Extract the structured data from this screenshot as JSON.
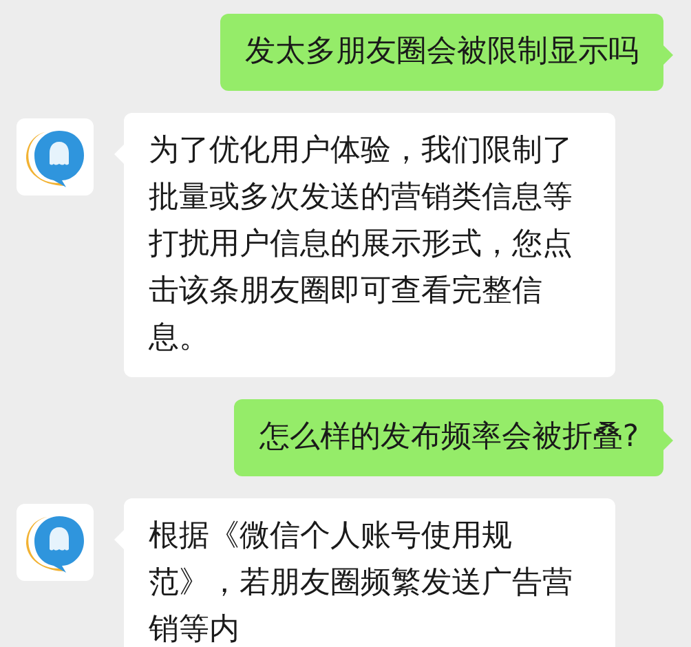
{
  "messages": [
    {
      "kind": "sent",
      "text": "发太多朋友圈会被限制显示吗"
    },
    {
      "kind": "received",
      "text": "为了优化用户体验，我们限制了批量或多次发送的营销类信息等打扰用户信息的展示形式，您点击该条朋友圈即可查看完整信息。"
    },
    {
      "kind": "sent",
      "text": "怎么样的发布频率会被折叠?"
    },
    {
      "kind": "received",
      "text": "根据《微信个人账号使用规范》，若朋友圈频繁发送广告营销等内"
    }
  ]
}
